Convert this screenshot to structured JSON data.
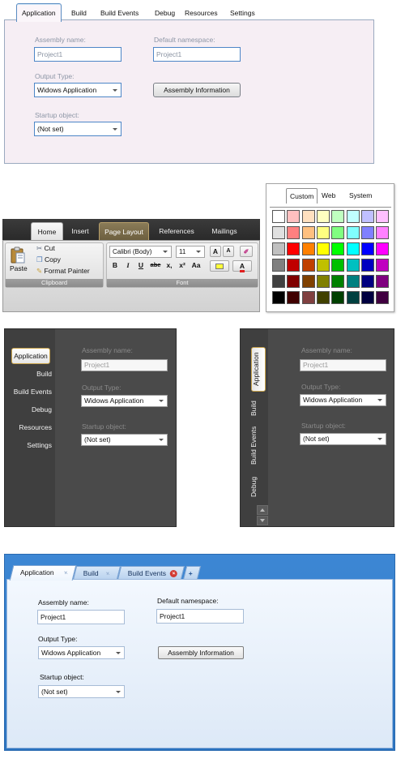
{
  "classic": {
    "tabs": [
      "Application",
      "Build",
      "Build Events",
      "Debug",
      "Resources",
      "Settings"
    ],
    "assembly_name_label": "Assembly name:",
    "assembly_name_value": "Project1",
    "default_namespace_label": "Default namespace:",
    "default_namespace_value": "Project1",
    "output_type_label": "Output Type:",
    "output_type_value": "Widows Application",
    "assembly_info_button": "Assembly Information",
    "startup_label": "Startup object:",
    "startup_value": "(Not set)"
  },
  "ribbon": {
    "tabs": [
      "Home",
      "Insert",
      "Page Layout",
      "References",
      "Mailings"
    ],
    "paste_label": "Paste",
    "cut_label": "Cut",
    "copy_label": "Copy",
    "format_painter_label": "Format Painter",
    "clipboard_group": "Clipboard",
    "font_name": "Calibri (Body)",
    "font_size": "11",
    "font_group": "Font",
    "format_buttons": [
      "B",
      "I",
      "U",
      "abe",
      "x,",
      "x²",
      "Aa"
    ],
    "grow_font": "A",
    "shrink_font": "A",
    "font_color_button": "A"
  },
  "color_picker": {
    "tabs": [
      "Custom",
      "Web",
      "System"
    ],
    "palette": [
      [
        "#ffffff",
        "#ffc0c0",
        "#ffe0c0",
        "#ffffc0",
        "#c0ffc0",
        "#c0ffff",
        "#c0c0ff",
        "#ffc0ff"
      ],
      [
        "#e0e0e0",
        "#ff8080",
        "#ffc080",
        "#ffff80",
        "#80ff80",
        "#80ffff",
        "#8080ff",
        "#ff80ff"
      ],
      [
        "#c0c0c0",
        "#ff0000",
        "#ff8000",
        "#ffff00",
        "#00ff00",
        "#00ffff",
        "#0000ff",
        "#ff00ff"
      ],
      [
        "#808080",
        "#c00000",
        "#c04000",
        "#c0c000",
        "#00c000",
        "#00c0c0",
        "#0000c0",
        "#c000c0"
      ],
      [
        "#404040",
        "#800000",
        "#804000",
        "#808000",
        "#008000",
        "#008080",
        "#000080",
        "#800080"
      ],
      [
        "#000000",
        "#400000",
        "#804040",
        "#404000",
        "#004000",
        "#004040",
        "#000040",
        "#400040"
      ]
    ]
  },
  "dark_nav": {
    "items": [
      "Application",
      "Build",
      "Build Events",
      "Debug",
      "Resources",
      "Settings"
    ],
    "assembly_name_label": "Assembly name:",
    "assembly_name_value": "Project1",
    "output_type_label": "Output Type:",
    "output_type_value": "Widows Application",
    "startup_label": "Startup object:",
    "startup_value": "(Not set)"
  },
  "dark_vertical": {
    "tabs": [
      "Application",
      "Build",
      "Build Events",
      "Debug"
    ],
    "assembly_name_label": "Assembly name:",
    "assembly_name_value": "Project1",
    "output_type_label": "Output Type:",
    "output_type_value": "Widows Application",
    "startup_label": "Startup object:",
    "startup_value": "(Not set)"
  },
  "blue": {
    "tabs": [
      "Application",
      "Build",
      "Build Events"
    ],
    "close_glyph": "×",
    "close_red_glyph": "×",
    "new_tab_glyph": "+",
    "assembly_name_label": "Assembly name:",
    "assembly_name_value": "Project1",
    "default_namespace_label": "Default namespace:",
    "default_namespace_value": "Project1",
    "output_type_label": "Output Type:",
    "output_type_value": "Widows Application",
    "assembly_info_button": "Assembly Information",
    "startup_label": "Startup object:",
    "startup_value": "(Not set)"
  }
}
